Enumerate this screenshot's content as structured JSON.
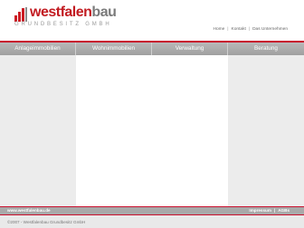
{
  "brand": {
    "name_main": "westfalen",
    "name_suffix": "bau",
    "subtitle": "GRUNDBESITZ GMBH"
  },
  "topnav": {
    "items": [
      "Home",
      "Kontakt",
      "Das Unternehmen"
    ]
  },
  "mainnav": {
    "items": [
      "Anlageimmobilien",
      "Wohnimmobilien",
      "Verwaltung",
      "Beratung"
    ]
  },
  "footer": {
    "url": "www.westfalenbau.de",
    "links": [
      "Impressum",
      "AGBs"
    ],
    "copyright": "©2007 - Westfalenbau Grundbesitz GmbH"
  },
  "colors": {
    "brand_red": "#c8102e",
    "nav_gray": "#a9a9a9"
  }
}
